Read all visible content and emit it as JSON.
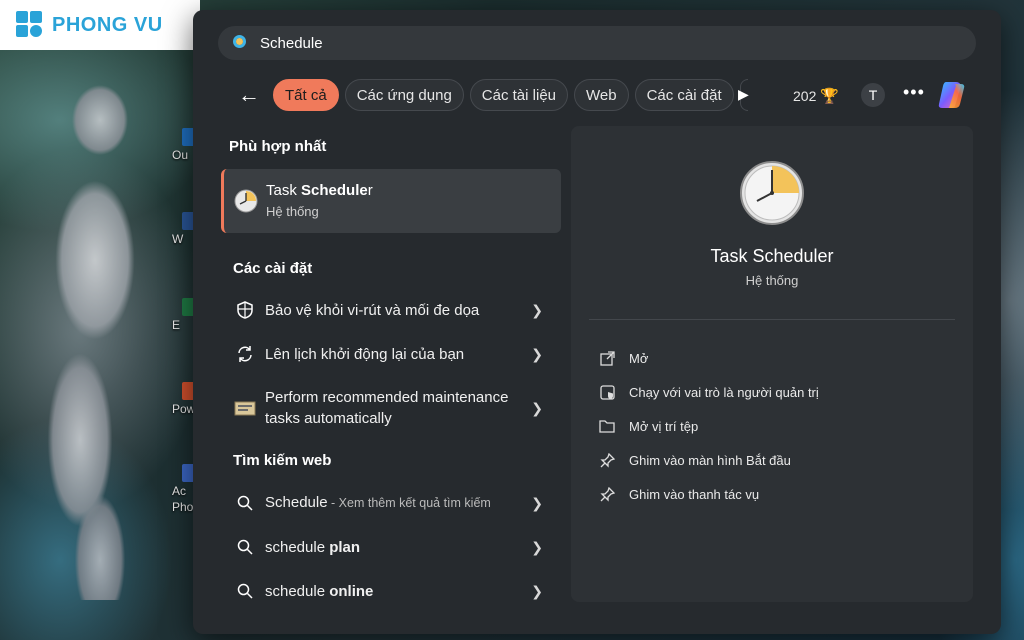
{
  "brand": {
    "logo_text": "PHONG VU"
  },
  "desktop": {
    "icons": [
      {
        "label": "Ou",
        "color": "#1f6fc1"
      },
      {
        "label": "W",
        "color": "#2a5699"
      },
      {
        "label": "E",
        "color": "#1f7a44"
      },
      {
        "label": "Pow",
        "color": "#d2502d"
      },
      {
        "label": "Ac",
        "color": "#3b67c5"
      },
      {
        "label": "Pho",
        "color": "#6b3fa0"
      }
    ]
  },
  "search": {
    "value": "Schedule"
  },
  "filters": {
    "back_icon": "back-arrow-icon",
    "chips": [
      "Tất cả",
      "Các ứng dụng",
      "Các tài liệu",
      "Web",
      "Các cài đặt"
    ],
    "active_index": 0,
    "points": "202",
    "avatar_initial": "T",
    "more_label": "•••"
  },
  "best_match": {
    "section_title": "Phù hợp nhất",
    "name_bold": "Task Schedul",
    "name_rest": "er",
    "name_prefix": "Task ",
    "name_bold_part": "Schedule",
    "name_suffix": "r",
    "subtitle": "Hệ thống"
  },
  "settings": {
    "section_title": "Các cài đặt",
    "items": [
      {
        "label": "Bảo vệ khỏi vi-rút và mối đe dọa",
        "icon": "shield-icon"
      },
      {
        "label": "Lên lịch khởi động lại của bạn",
        "icon": "refresh-icon"
      },
      {
        "label": "Perform recommended maintenance tasks automatically",
        "icon": "control-panel-icon"
      }
    ]
  },
  "web": {
    "section_title": "Tìm kiếm web",
    "items": [
      {
        "prefix": "Schedule",
        "rest": " - Xem thêm kết quả tìm kiếm"
      },
      {
        "prefix": "schedule",
        "rest": " plan"
      },
      {
        "prefix": "schedule",
        "rest": " online"
      }
    ]
  },
  "preview": {
    "title": "Task Scheduler",
    "subtitle": "Hệ thống",
    "actions": [
      {
        "label": "Mở",
        "icon": "open-external-icon"
      },
      {
        "label": "Chạy với vai trò là người quản trị",
        "icon": "admin-shield-icon"
      },
      {
        "label": "Mở vị trí tệp",
        "icon": "folder-icon"
      },
      {
        "label": "Ghim vào màn hình Bắt đầu",
        "icon": "pin-icon"
      },
      {
        "label": "Ghim vào thanh tác vụ",
        "icon": "pin-icon"
      }
    ]
  },
  "colors": {
    "accent": "#f07a5b",
    "panel": "#262a2e",
    "preview": "#2d3135"
  }
}
